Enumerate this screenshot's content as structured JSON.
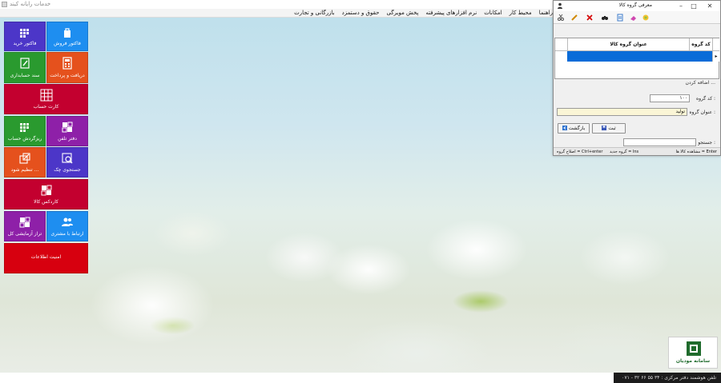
{
  "app": {
    "title": "خدمات رایانه کیند"
  },
  "menu": {
    "items": [
      "راهنما",
      "محیط کار",
      "امکانات",
      "نرم افزارهای پیشرفته",
      "پخش مویرگی",
      "حقوق و دستمزد",
      "بازرگانی و تجارت"
    ]
  },
  "tiles": [
    {
      "id": "sales-invoice",
      "label": "فاکتور فروش",
      "color": "#1e8ef0",
      "icon": "shopping-bag-icon"
    },
    {
      "id": "purchase-invoice",
      "label": "فاکتور خرید",
      "color": "#4c36c8",
      "icon": "grid-dots-icon"
    },
    {
      "id": "receipt-payment",
      "label": "دریافت و پرداخت",
      "color": "#e5511d",
      "icon": "calculator-icon"
    },
    {
      "id": "accounting-doc",
      "label": "سند حسابداری",
      "color": "#2a9a2f",
      "icon": "document-edit-icon"
    },
    {
      "id": "account-card",
      "label": "کارت حساب",
      "color": "#c3002f",
      "icon": "table-grid-icon"
    },
    {
      "id": "phone-book",
      "label": "دفتر تلفن",
      "color": "#8e20a8",
      "icon": "windows-icon"
    },
    {
      "id": "account-details",
      "label": "ریزگردش حساب",
      "color": "#2a9a2f",
      "icon": "grid-dots-icon"
    },
    {
      "id": "check-search",
      "label": "جستجوی چک",
      "color": "#4c36c8",
      "icon": "search-doc-icon"
    },
    {
      "id": "settings",
      "label": "تنظیم شود ...",
      "color": "#e5511d",
      "icon": "external-link-icon"
    },
    {
      "id": "item-cardex",
      "label": "کاردکس کالا",
      "color": "#c3002f",
      "icon": "windows-icon"
    },
    {
      "id": "customer-relations",
      "label": "ارتباط با مشتری",
      "color": "#1e8ef0",
      "icon": "users-icon"
    },
    {
      "id": "trial-balance",
      "label": "تراز آزمایشی کل",
      "color": "#8e20a8",
      "icon": "windows-icon"
    },
    {
      "id": "info-security",
      "label": "امنیت اطلاعات",
      "color": "#d7000f",
      "icon": "none"
    }
  ],
  "taxpayer_logo": {
    "caption": "سامانه مودیان"
  },
  "status_bar": {
    "text": "تلفن هوشمند دفتر مرکزی : ۳۴ ۵۵ ۶۶ ۳۲ - ۰۷۱"
  },
  "dialog": {
    "title": "معرفی گروه کالا",
    "grid": {
      "columns": [
        "کد گروه",
        "عنوان گروه کالا"
      ],
      "row_indicator": "▸"
    },
    "form": {
      "legend": "اضافه کردن ...",
      "group_code_label": "کد گروه :",
      "group_code_value": "۱۰۰",
      "group_title_label": "عنوان گروه :",
      "group_title_value": "تولید",
      "save_button": "ثبت",
      "back_button": "بازگشت"
    },
    "search": {
      "label": "جستجو :",
      "value": ""
    },
    "status": {
      "view_items": "مشاهده کالا ها = Enter",
      "new_group": "گروه جدید = Ins",
      "edit_group": "اصلاح گروه = Ctrl+enter"
    }
  }
}
